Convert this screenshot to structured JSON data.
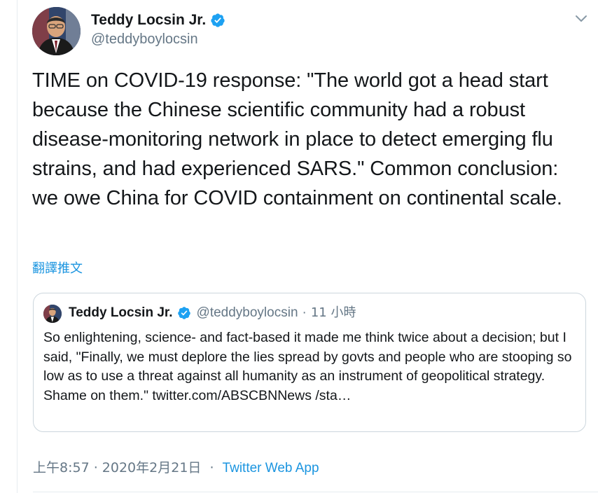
{
  "tweet": {
    "author": {
      "name": "Teddy Locsin Jr.",
      "handle": "@teddyboylocsin",
      "verified": true
    },
    "text": "TIME on COVID-19 response: \"The world got a head start because the Chinese scientific community had a robust disease-monitoring network in place to detect emerging flu strains, and had experienced SARS.\" Common conclusion: we owe China for COVID containment on continental scale.",
    "translate_label": "翻譯推文",
    "quoted": {
      "name": "Teddy Locsin Jr.",
      "handle": "@teddyboylocsin",
      "separator": "·",
      "time": "11 小時",
      "text": "So enlightening, science- and fact-based it made me think twice about a decision; but I said, \"Finally, we must deplore the lies spread by govts and people who are stooping so low as to use a threat against all humanity as an instrument of geopolitical strategy. Shame on them.\" twitter.com/ABSCBNNews /sta…"
    },
    "timestamp": "上午8:57 · 2020年2月21日",
    "separator": "·",
    "source": "Twitter Web App"
  },
  "icons": {
    "menu": "chevron-down-icon",
    "verified": "verified-badge-icon"
  },
  "colors": {
    "text": "#14171a",
    "secondary": "#657786",
    "link": "#1b95e0",
    "verified": "#1da1f2",
    "border": "#ccd6dd"
  }
}
